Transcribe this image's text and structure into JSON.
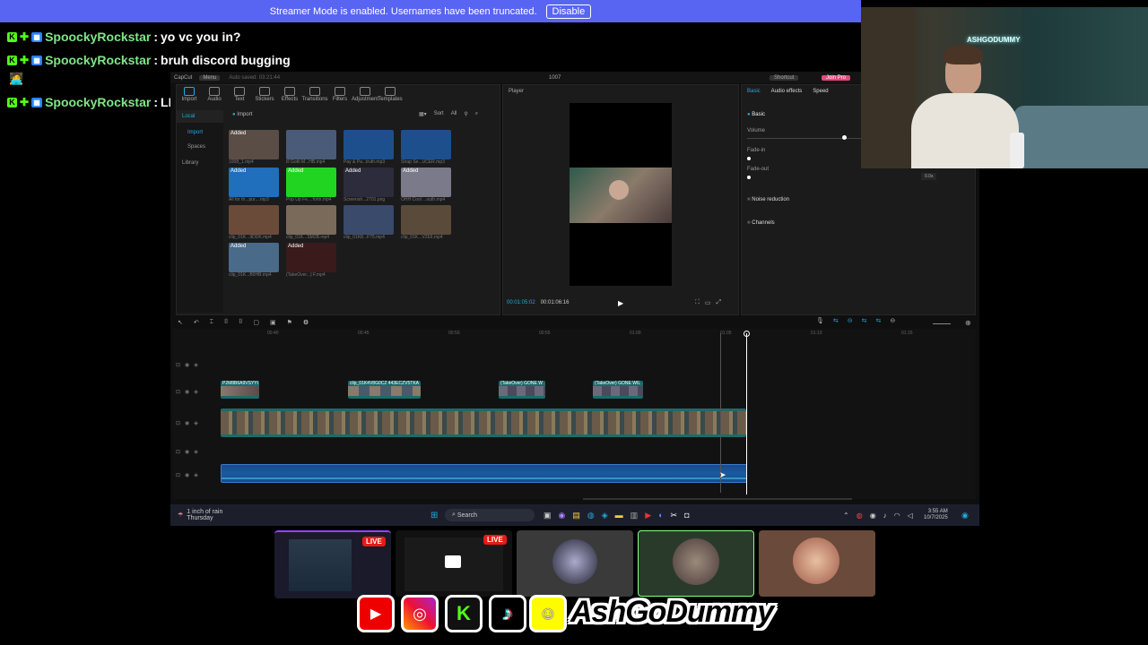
{
  "banner": {
    "text": "Streamer Mode is enabled. Usernames have been truncated.",
    "button": "Disable"
  },
  "chat": [
    {
      "user": "SpoockyRockstar",
      "message": "yo vc you in?"
    },
    {
      "user": "SpoockyRockstar",
      "message": "bruh discord bugging"
    },
    {
      "user": "SpoockyRockstar",
      "message": "LMAO"
    }
  ],
  "editor": {
    "app_name": "CapCut",
    "menu_label": "Menu",
    "autosave": "Auto saved: 03:21:44",
    "project_title": "1007",
    "shortcut_label": "Shortcut",
    "join_pro_label": "Join Pro",
    "toolbar": [
      "Import",
      "Audio",
      "Text",
      "Stickers",
      "Effects",
      "Transitions",
      "Filters",
      "Adjustment",
      "Templates"
    ],
    "sidebar": [
      "Local",
      "Import",
      "Spaces",
      "Library"
    ],
    "import_label": "Import",
    "sort_label": "Sort",
    "all_label": "All",
    "media": [
      {
        "tag": "Added",
        "caption": "1008_1.mp4",
        "color": "#5a4d45"
      },
      {
        "tag": "",
        "caption": "Ill Gotti M...HB.mp4",
        "color": "#4a5b7a"
      },
      {
        "tag": "",
        "caption": "Pay & Pa...truth.mp3",
        "color": "#1d4f8c"
      },
      {
        "tag": "",
        "caption": "Strap Se...UCER.mp3",
        "color": "#1d4f8c"
      },
      {
        "tag": "Added",
        "caption": "All for th...pur....mp3",
        "color": "#1f6fbd"
      },
      {
        "tag": "Added",
        "caption": "Pop Up Fe....fortn.mp4",
        "color": "#22d422"
      },
      {
        "tag": "Added",
        "caption": "Screensh...2701.png",
        "color": "#2c2c3c"
      },
      {
        "tag": "Added",
        "caption": "OHH Cool ...outh.mp4",
        "color": "#7a7a8a"
      },
      {
        "tag": "",
        "caption": "clip_01K...9DDK.mp4",
        "color": "#6a4b3a"
      },
      {
        "tag": "",
        "caption": "clip_01K...SM2B.mp4",
        "color": "#7a6a5a"
      },
      {
        "tag": "",
        "caption": "clip_01K8...F75.mp4",
        "color": "#3a4a6a"
      },
      {
        "tag": "",
        "caption": "clip_01K...V2E6.mp4",
        "color": "#5a4a3a"
      },
      {
        "tag": "Added",
        "caption": "clip_01K...B0HB.mp4",
        "color": "#4a6a8a"
      },
      {
        "tag": "Added",
        "caption": "(TakeOver...) F.mp4",
        "color": "#3a1a1a"
      }
    ],
    "player_label": "Player",
    "timecode_current": "00:01:05:02",
    "timecode_total": "00:01:06:16",
    "props_tabs": [
      "Basic",
      "Audio effects",
      "Speed"
    ],
    "props": {
      "basic": "Basic",
      "volume": "Volume",
      "fade_in": "Fade-in",
      "fade_out": "Fade-out",
      "fade_value": "0.0s",
      "noise_reduction": "Noise reduction",
      "channels": "Channels"
    },
    "ruler": [
      "00:40",
      "00:45",
      "00:50",
      "00:55",
      "01:00",
      "01:05",
      "01:10",
      "01:15"
    ],
    "clips_top": [
      {
        "label": "P2M8B6A9VSYYI"
      },
      {
        "label": "clip_01K4V8G0CZ 443ECZV5TKA"
      },
      {
        "label": "(TakeOver) GONE W"
      },
      {
        "label": "(TakeOver) GONE WIL"
      }
    ]
  },
  "taskbar": {
    "weather": "1 inch of rain",
    "weather_day": "Thursday",
    "search": "Search",
    "time": "3:55 AM",
    "date": "10/7/2025"
  },
  "streams": [
    {
      "live": "LIVE"
    },
    {
      "live": "LIVE"
    },
    {
      "live": ""
    },
    {
      "live": ""
    },
    {
      "live": ""
    }
  ],
  "socials": [
    "youtube-icon",
    "instagram-icon",
    "kick-icon",
    "tiktok-icon",
    "snapchat-icon"
  ],
  "handle": "AshGoDummy",
  "cam_sign": "ASHGODUMMY"
}
